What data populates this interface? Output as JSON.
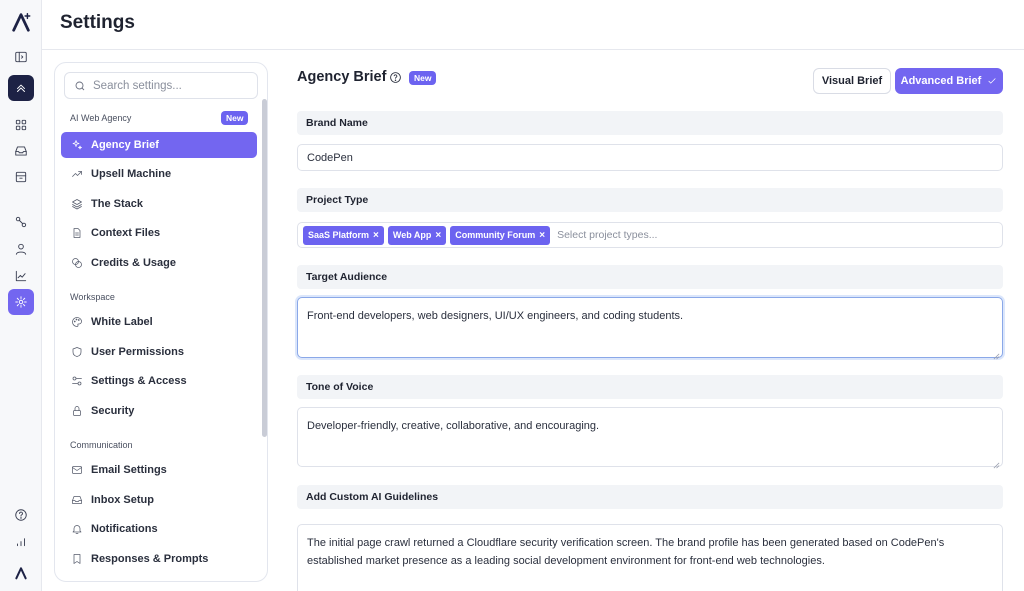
{
  "header": {
    "title": "Settings"
  },
  "search": {
    "placeholder": "Search settings..."
  },
  "sidebar": {
    "sections": [
      {
        "label": "AI Web Agency",
        "badge": "New",
        "items": [
          {
            "label": "Agency Brief",
            "icon": "sparkles-icon",
            "active": true
          },
          {
            "label": "Upsell Machine",
            "icon": "trending-up-icon"
          },
          {
            "label": "The Stack",
            "icon": "layers-icon"
          },
          {
            "label": "Context Files",
            "icon": "file-icon"
          },
          {
            "label": "Credits & Usage",
            "icon": "coins-icon"
          }
        ]
      },
      {
        "label": "Workspace",
        "items": [
          {
            "label": "White Label",
            "icon": "palette-icon"
          },
          {
            "label": "User Permissions",
            "icon": "shield-icon"
          },
          {
            "label": "Settings & Access",
            "icon": "toggles-icon"
          },
          {
            "label": "Security",
            "icon": "lock-icon"
          }
        ]
      },
      {
        "label": "Communication",
        "items": [
          {
            "label": "Email Settings",
            "icon": "mail-icon"
          },
          {
            "label": "Inbox Setup",
            "icon": "inbox-icon"
          },
          {
            "label": "Notifications",
            "icon": "bell-icon"
          },
          {
            "label": "Responses & Prompts",
            "icon": "bookmark-icon"
          }
        ]
      }
    ]
  },
  "main": {
    "title": "Agency Brief",
    "badge": "New",
    "buttons": {
      "visual": "Visual Brief",
      "advanced": "Advanced Brief"
    },
    "fields": {
      "brand_name": {
        "label": "Brand Name",
        "value": "CodePen"
      },
      "project_type": {
        "label": "Project Type",
        "tags": [
          "SaaS Platform",
          "Web App",
          "Community Forum"
        ],
        "placeholder": "Select project types..."
      },
      "target_audience": {
        "label": "Target Audience",
        "value": "Front-end developers, web designers, UI/UX engineers, and coding students."
      },
      "tone": {
        "label": "Tone of Voice",
        "value": "Developer-friendly, creative, collaborative, and encouraging."
      },
      "guidelines": {
        "label": "Add Custom AI Guidelines",
        "value": "The initial page crawl returned a Cloudflare security verification screen. The brand profile has been generated based on CodePen's established market presence as a leading social development environment for front-end web technologies."
      }
    }
  },
  "colors": {
    "accent": "#7366f0",
    "dark": "#1d2245"
  }
}
